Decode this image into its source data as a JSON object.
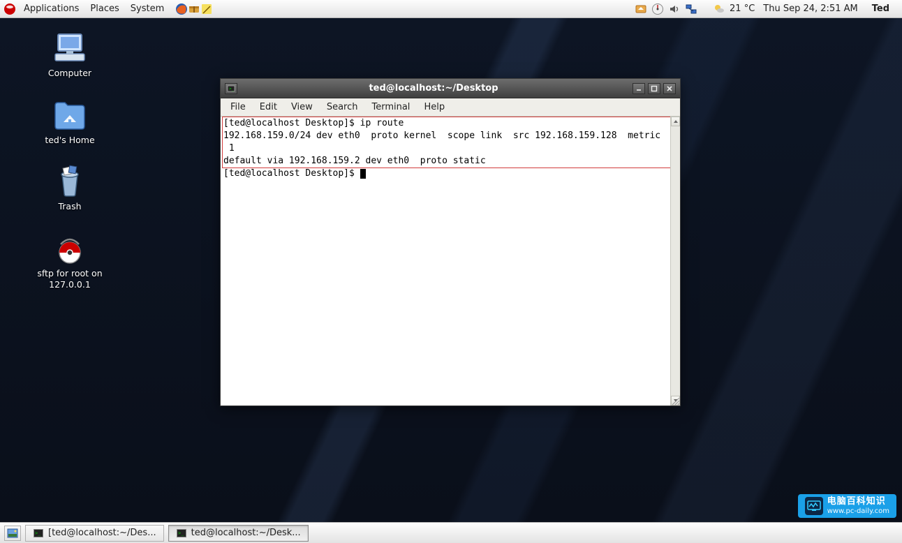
{
  "top_panel": {
    "menus": {
      "applications": "Applications",
      "places": "Places",
      "system": "System"
    },
    "temperature": "21 °C",
    "clock": "Thu Sep 24,  2:51 AM",
    "username": "Ted"
  },
  "desktop": {
    "computer": "Computer",
    "home": "ted's Home",
    "trash": "Trash",
    "sftp": "sftp for root on 127.0.0.1"
  },
  "terminal": {
    "title": "ted@localhost:~/Desktop",
    "menubar": {
      "file": "File",
      "edit": "Edit",
      "view": "View",
      "search": "Search",
      "terminal": "Terminal",
      "help": "Help"
    },
    "lines": {
      "l0": "[ted@localhost Desktop]$ ip route",
      "l1": "192.168.159.0/24 dev eth0  proto kernel  scope link  src 192.168.159.128  metric",
      "l2": " 1",
      "l3": "default via 192.168.159.2 dev eth0  proto static",
      "l4": "[ted@localhost Desktop]$ "
    }
  },
  "taskbar": {
    "task1": "[ted@localhost:~/Des...",
    "task2": "ted@localhost:~/Desk..."
  },
  "watermark": {
    "line1": "电脑百科知识",
    "line2": "www.pc-daily.com"
  }
}
